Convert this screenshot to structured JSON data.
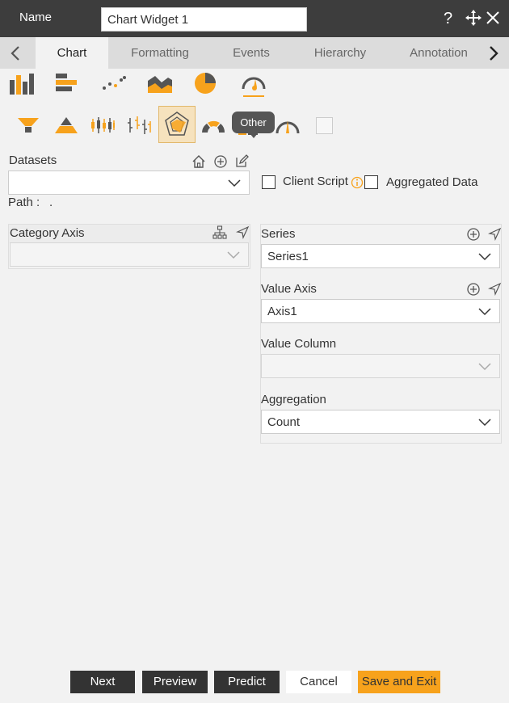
{
  "header": {
    "name_label": "Name",
    "name_value": "Chart Widget 1",
    "help_icon": "question-icon",
    "move_icon": "move-icon",
    "close_icon": "close-icon"
  },
  "tabs": [
    {
      "label": "Chart",
      "active": true
    },
    {
      "label": "Formatting",
      "active": false
    },
    {
      "label": "Events",
      "active": false
    },
    {
      "label": "Hierarchy",
      "active": false
    },
    {
      "label": "Annotation",
      "active": false
    }
  ],
  "chart_types": {
    "row1": [
      "column-chart-icon",
      "bar-chart-icon",
      "scatter-chart-icon",
      "area-chart-icon",
      "pie-chart-icon",
      "gauge-chart-icon"
    ],
    "row2": [
      "funnel-chart-icon",
      "pyramid-chart-icon",
      "candlestick-chart-icon",
      "ohlc-chart-icon",
      "radar-chart-icon",
      "semi-donut-chart-icon",
      "other-chart-icon",
      "meter-chart-icon",
      "empty-chart-icon"
    ],
    "selected": "radar-chart-icon",
    "tooltip": "Other"
  },
  "datasets": {
    "label": "Datasets",
    "value": "",
    "path_label": "Path :",
    "path_value": "."
  },
  "options": {
    "client_script": "Client Script",
    "aggregated_data": "Aggregated Data"
  },
  "category_axis": {
    "label": "Category Axis",
    "value": ""
  },
  "series": {
    "label": "Series",
    "value": "Series1"
  },
  "value_axis": {
    "label": "Value Axis",
    "value": "Axis1"
  },
  "value_column": {
    "label": "Value Column",
    "value": ""
  },
  "aggregation": {
    "label": "Aggregation",
    "value": "Count"
  },
  "footer": {
    "next": "Next",
    "preview": "Preview",
    "predict": "Predict",
    "cancel": "Cancel",
    "save_exit": "Save and Exit"
  },
  "colors": {
    "accent": "#f7a21c",
    "dark": "#3d3d3d",
    "icon_grey": "#555555"
  }
}
